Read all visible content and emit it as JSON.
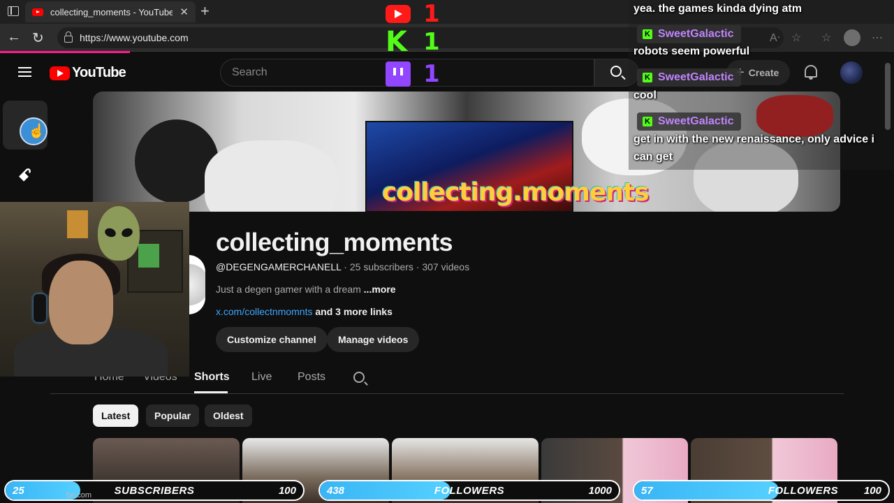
{
  "browser": {
    "tab_title": "collecting_moments - YouTube",
    "url": "https://www.youtube.com",
    "status_url": "be.com"
  },
  "youtube": {
    "logo_text": "YouTube",
    "search_placeholder": "Search",
    "create_label": "Create"
  },
  "channel": {
    "name": "collecting_moments",
    "handle": "@DEGENGAMERCHANELL",
    "subscribers": "25 subscribers",
    "videos": "307 videos",
    "separator": " · ",
    "description": "Just a degen gamer with a dream",
    "more": "...more",
    "link": "x.com/collectnmomnts",
    "more_links": "and 3 more links",
    "customize_label": "Customize channel",
    "manage_label": "Manage videos",
    "banner_text": "collecting.moments"
  },
  "tabs": [
    {
      "label": "Home"
    },
    {
      "label": "Videos"
    },
    {
      "label": "Shorts",
      "active": true
    },
    {
      "label": "Live"
    },
    {
      "label": "Posts"
    }
  ],
  "chips": [
    {
      "label": "Latest",
      "selected": true
    },
    {
      "label": "Popular",
      "selected": false
    },
    {
      "label": "Oldest",
      "selected": false
    }
  ],
  "overlay": {
    "platforms": [
      {
        "icon": "youtube-icon",
        "count": "1"
      },
      {
        "icon": "kick-icon",
        "count": "1"
      },
      {
        "icon": "twitch-icon",
        "count": "1"
      }
    ],
    "chat": [
      {
        "user": "",
        "message": "yea. the games kinda dying atm"
      },
      {
        "user": "SweetGalactic",
        "message": "robots seem powerful"
      },
      {
        "user": "SweetGalactic",
        "message": "cool"
      },
      {
        "user": "SweetGalactic",
        "message": "get in with the new renaissance, only advice i can get"
      }
    ],
    "goals": [
      {
        "current": "25",
        "label": "SUBSCRIBERS",
        "max": "100",
        "fraction": 0.25
      },
      {
        "current": "438",
        "label": "FOLLOWERS",
        "max": "1000",
        "fraction": 0.438
      },
      {
        "current": "57",
        "label": "FOLLOWERS",
        "max": "100",
        "fraction": 0.57
      }
    ]
  },
  "colors": {
    "accent": "#ff0000",
    "kick": "#53fc18",
    "twitch": "#9146ff",
    "link": "#3ea6ff",
    "goal_fill": "#39b5f5"
  }
}
